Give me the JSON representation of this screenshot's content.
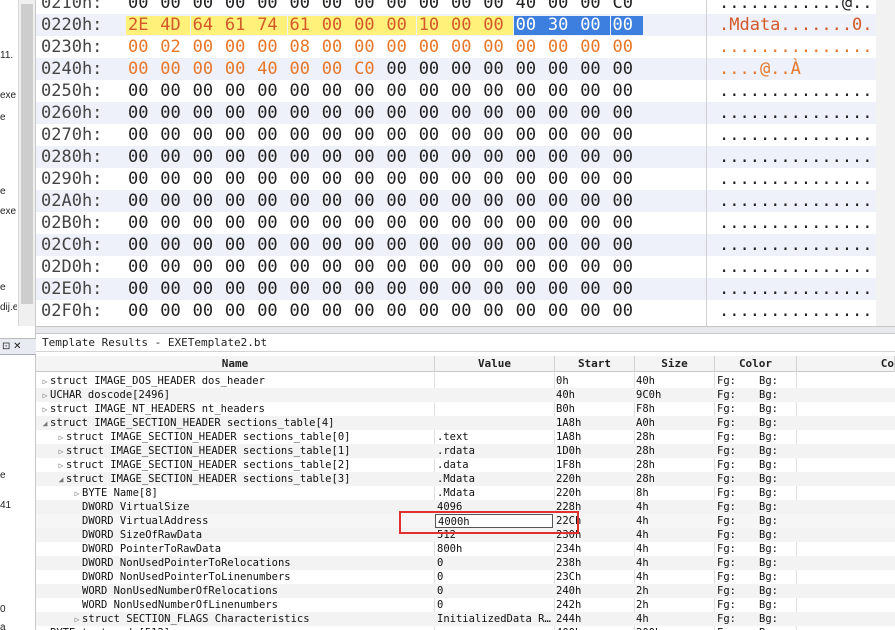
{
  "hex": {
    "rows": [
      {
        "addr": "0210h:",
        "bytes": [
          "00",
          "00",
          "00",
          "00",
          "00",
          "00",
          "00",
          "00",
          "00",
          "00",
          "00",
          "00",
          "40",
          "00",
          "00",
          "C0"
        ],
        "ascii": "............@..",
        "hl": []
      },
      {
        "addr": "0220h:",
        "bytes": [
          "2E",
          "4D",
          "64",
          "61",
          "74",
          "61",
          "00",
          "00",
          "00",
          "10",
          "00",
          "00",
          "00",
          "30",
          "00",
          "00"
        ],
        "ascii": ".Mdata.......0.",
        "hl": [
          "y",
          "y",
          "y",
          "y",
          "y",
          "y",
          "y",
          "y",
          "y",
          "y",
          "y",
          "y",
          "b",
          "b",
          "b",
          "b"
        ]
      },
      {
        "addr": "0230h:",
        "bytes": [
          "00",
          "02",
          "00",
          "00",
          "00",
          "08",
          "00",
          "00",
          "00",
          "00",
          "00",
          "00",
          "00",
          "00",
          "00",
          "00"
        ],
        "ascii": "................",
        "hl": [
          "o",
          "o",
          "o",
          "o",
          "o",
          "o",
          "o",
          "o",
          "o",
          "o",
          "o",
          "o",
          "o",
          "o",
          "o",
          "o"
        ]
      },
      {
        "addr": "0240h:",
        "bytes": [
          "00",
          "00",
          "00",
          "00",
          "40",
          "00",
          "00",
          "C0",
          "00",
          "00",
          "00",
          "00",
          "00",
          "00",
          "00",
          "00"
        ],
        "ascii": "....@..À",
        "hl": [
          "o",
          "o",
          "o",
          "o",
          "o",
          "o",
          "o",
          "o"
        ]
      },
      {
        "addr": "0250h:",
        "bytes": [
          "00",
          "00",
          "00",
          "00",
          "00",
          "00",
          "00",
          "00",
          "00",
          "00",
          "00",
          "00",
          "00",
          "00",
          "00",
          "00"
        ],
        "ascii": "................",
        "hl": []
      },
      {
        "addr": "0260h:",
        "bytes": [
          "00",
          "00",
          "00",
          "00",
          "00",
          "00",
          "00",
          "00",
          "00",
          "00",
          "00",
          "00",
          "00",
          "00",
          "00",
          "00"
        ],
        "ascii": "................",
        "hl": []
      },
      {
        "addr": "0270h:",
        "bytes": [
          "00",
          "00",
          "00",
          "00",
          "00",
          "00",
          "00",
          "00",
          "00",
          "00",
          "00",
          "00",
          "00",
          "00",
          "00",
          "00"
        ],
        "ascii": "................",
        "hl": []
      },
      {
        "addr": "0280h:",
        "bytes": [
          "00",
          "00",
          "00",
          "00",
          "00",
          "00",
          "00",
          "00",
          "00",
          "00",
          "00",
          "00",
          "00",
          "00",
          "00",
          "00"
        ],
        "ascii": "................",
        "hl": []
      },
      {
        "addr": "0290h:",
        "bytes": [
          "00",
          "00",
          "00",
          "00",
          "00",
          "00",
          "00",
          "00",
          "00",
          "00",
          "00",
          "00",
          "00",
          "00",
          "00",
          "00"
        ],
        "ascii": "................",
        "hl": []
      },
      {
        "addr": "02A0h:",
        "bytes": [
          "00",
          "00",
          "00",
          "00",
          "00",
          "00",
          "00",
          "00",
          "00",
          "00",
          "00",
          "00",
          "00",
          "00",
          "00",
          "00"
        ],
        "ascii": "................",
        "hl": []
      },
      {
        "addr": "02B0h:",
        "bytes": [
          "00",
          "00",
          "00",
          "00",
          "00",
          "00",
          "00",
          "00",
          "00",
          "00",
          "00",
          "00",
          "00",
          "00",
          "00",
          "00"
        ],
        "ascii": "................",
        "hl": []
      },
      {
        "addr": "02C0h:",
        "bytes": [
          "00",
          "00",
          "00",
          "00",
          "00",
          "00",
          "00",
          "00",
          "00",
          "00",
          "00",
          "00",
          "00",
          "00",
          "00",
          "00"
        ],
        "ascii": "................",
        "hl": []
      },
      {
        "addr": "02D0h:",
        "bytes": [
          "00",
          "00",
          "00",
          "00",
          "00",
          "00",
          "00",
          "00",
          "00",
          "00",
          "00",
          "00",
          "00",
          "00",
          "00",
          "00"
        ],
        "ascii": "................",
        "hl": []
      },
      {
        "addr": "02E0h:",
        "bytes": [
          "00",
          "00",
          "00",
          "00",
          "00",
          "00",
          "00",
          "00",
          "00",
          "00",
          "00",
          "00",
          "00",
          "00",
          "00",
          "00"
        ],
        "ascii": "................",
        "hl": []
      },
      {
        "addr": "02F0h:",
        "bytes": [
          "00",
          "00",
          "00",
          "00",
          "00",
          "00",
          "00",
          "00",
          "00",
          "00",
          "00",
          "00",
          "00",
          "00",
          "00",
          "00"
        ],
        "ascii": "................",
        "hl": []
      }
    ]
  },
  "left_strip": {
    "fragments": [
      "11.",
      "exe",
      "e",
      "e",
      "exe",
      "e",
      "dij.e",
      "e",
      "41",
      "0",
      "a"
    ],
    "tab_glyph": "⊡ ✕"
  },
  "template": {
    "title": "Template Results - EXETemplate2.bt",
    "columns": {
      "name": "Name",
      "value": "Value",
      "start": "Start",
      "size": "Size",
      "color": "Color",
      "comment": "Co"
    },
    "rows": [
      {
        "indent": 0,
        "tri": "▷",
        "name": "struct IMAGE_DOS_HEADER dos_header",
        "value": "",
        "start": "0h",
        "size": "40h",
        "fg": "Fg:",
        "bg": "Bg:"
      },
      {
        "indent": 0,
        "tri": "▷",
        "name": "UCHAR doscode[2496]",
        "value": "",
        "start": "40h",
        "size": "9C0h",
        "fg": "Fg:",
        "bg": "Bg:"
      },
      {
        "indent": 0,
        "tri": "▷",
        "name": "struct IMAGE_NT_HEADERS nt_headers",
        "value": "",
        "start": "B0h",
        "size": "F8h",
        "fg": "Fg:",
        "bg": "Bg:"
      },
      {
        "indent": 0,
        "tri": "◢",
        "name": "struct IMAGE_SECTION_HEADER sections_table[4]",
        "value": "",
        "start": "1A8h",
        "size": "A0h",
        "fg": "Fg:",
        "bg": "Bg:"
      },
      {
        "indent": 1,
        "tri": "▷",
        "name": "struct IMAGE_SECTION_HEADER sections_table[0]",
        "value": ".text",
        "start": "1A8h",
        "size": "28h",
        "fg": "Fg:",
        "bg": "Bg:"
      },
      {
        "indent": 1,
        "tri": "▷",
        "name": "struct IMAGE_SECTION_HEADER sections_table[1]",
        "value": ".rdata",
        "start": "1D0h",
        "size": "28h",
        "fg": "Fg:",
        "bg": "Bg:"
      },
      {
        "indent": 1,
        "tri": "▷",
        "name": "struct IMAGE_SECTION_HEADER sections_table[2]",
        "value": ".data",
        "start": "1F8h",
        "size": "28h",
        "fg": "Fg:",
        "bg": "Bg:"
      },
      {
        "indent": 1,
        "tri": "◢",
        "name": "struct IMAGE_SECTION_HEADER sections_table[3]",
        "value": ".Mdata",
        "start": "220h",
        "size": "28h",
        "fg": "Fg:",
        "bg": "Bg:"
      },
      {
        "indent": 2,
        "tri": "▷",
        "name": "BYTE Name[8]",
        "value": ".Mdata",
        "start": "220h",
        "size": "8h",
        "fg": "Fg:",
        "bg": "Bg:"
      },
      {
        "indent": 2,
        "tri": "",
        "name": "DWORD VirtualSize",
        "value": "4096",
        "start": "228h",
        "size": "4h",
        "fg": "Fg:",
        "bg": "Bg:"
      },
      {
        "indent": 2,
        "tri": "",
        "name": "DWORD VirtualAddress",
        "value": "4000h",
        "start": "22Ch",
        "size": "4h",
        "fg": "Fg:",
        "bg": "Bg:",
        "editing": true
      },
      {
        "indent": 2,
        "tri": "",
        "name": "DWORD SizeOfRawData",
        "value": "512",
        "start": "230h",
        "size": "4h",
        "fg": "Fg:",
        "bg": "Bg:"
      },
      {
        "indent": 2,
        "tri": "",
        "name": "DWORD PointerToRawData",
        "value": "800h",
        "start": "234h",
        "size": "4h",
        "fg": "Fg:",
        "bg": "Bg:"
      },
      {
        "indent": 2,
        "tri": "",
        "name": "DWORD NonUsedPointerToRelocations",
        "value": "0",
        "start": "238h",
        "size": "4h",
        "fg": "Fg:",
        "bg": "Bg:"
      },
      {
        "indent": 2,
        "tri": "",
        "name": "DWORD NonUsedPointerToLinenumbers",
        "value": "0",
        "start": "23Ch",
        "size": "4h",
        "fg": "Fg:",
        "bg": "Bg:"
      },
      {
        "indent": 2,
        "tri": "",
        "name": "WORD NonUsedNumberOfRelocations",
        "value": "0",
        "start": "240h",
        "size": "2h",
        "fg": "Fg:",
        "bg": "Bg:"
      },
      {
        "indent": 2,
        "tri": "",
        "name": "WORD NonUsedNumberOfLinenumbers",
        "value": "0",
        "start": "242h",
        "size": "2h",
        "fg": "Fg:",
        "bg": "Bg:"
      },
      {
        "indent": 2,
        "tri": "▷",
        "name": "struct SECTION_FLAGS Characteristics",
        "value": "InitializedData R…",
        "start": "244h",
        "size": "4h",
        "fg": "Fg:",
        "bg": "Bg:"
      },
      {
        "indent": 0,
        "tri": "▷",
        "name": "BYTE text_code[512]",
        "value": "",
        "start": "400h",
        "size": "200h",
        "fg": "Fg:",
        "bg": "Bg:"
      }
    ]
  },
  "colors": {
    "highlight_yellow": "#fff17a",
    "highlight_orange": "#e7772a",
    "highlight_blue": "#3d7fdf",
    "red_annotation": "#e03030"
  }
}
